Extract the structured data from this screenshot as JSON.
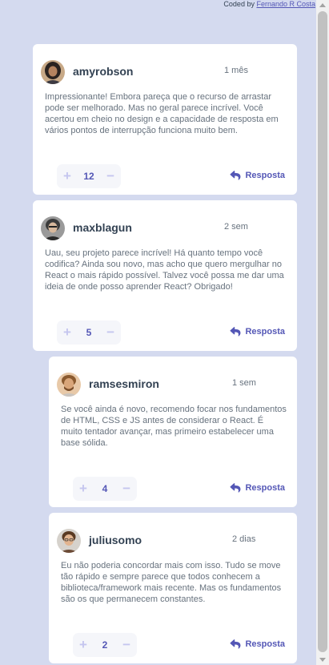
{
  "credit": {
    "prefix": "Coded by ",
    "author": "Fernando R Costa"
  },
  "comments": [
    {
      "username": "amyrobson",
      "time": "1 mês",
      "content": "Impressionante! Embora pareça que o recurso de arrastar pode ser melhorado. Mas no geral parece incrível. Você acertou em cheio no design e a capacidade de resposta em vários pontos de interrupção funciona muito bem.",
      "score": "12",
      "reply_label": "Resposta",
      "avatar_icon": "avatar-amyrobson-icon"
    },
    {
      "username": "maxblagun",
      "time": "2 sem",
      "content": "Uau, seu projeto parece incrível! Há quanto tempo você codifica? Ainda sou novo, mas acho que quero mergulhar no React o mais rápido possível. Talvez você possa me dar uma ideia de onde posso aprender React? Obrigado!",
      "score": "5",
      "reply_label": "Resposta",
      "avatar_icon": "avatar-maxblagun-icon"
    }
  ],
  "replies": [
    {
      "username": "ramsesmiron",
      "time": "1 sem",
      "content": "Se você ainda é novo, recomendo focar nos fundamentos de HTML, CSS e JS antes de considerar o React. É muito tentador avançar, mas primeiro estabelecer uma base sólida.",
      "score": "4",
      "reply_label": "Resposta",
      "avatar_icon": "avatar-ramsesmiron-icon"
    },
    {
      "username": "juliusomo",
      "time": "2 dias",
      "content": "Eu não poderia concordar mais com isso. Tudo se move tão rápido e sempre parece que todos conhecem a biblioteca/framework mais recente. Mas os fundamentos são os que permanecem constantes.",
      "score": "2",
      "reply_label": "Resposta",
      "avatar_icon": "avatar-juliusomo-icon"
    }
  ],
  "vote_controls": {
    "plus": "+",
    "minus": "−"
  },
  "colors": {
    "background": "#d4daef",
    "card": "#ffffff",
    "accent": "#5457b6",
    "vote_icon": "#c5c6ef",
    "username": "#334253",
    "body_text": "#67727e"
  }
}
